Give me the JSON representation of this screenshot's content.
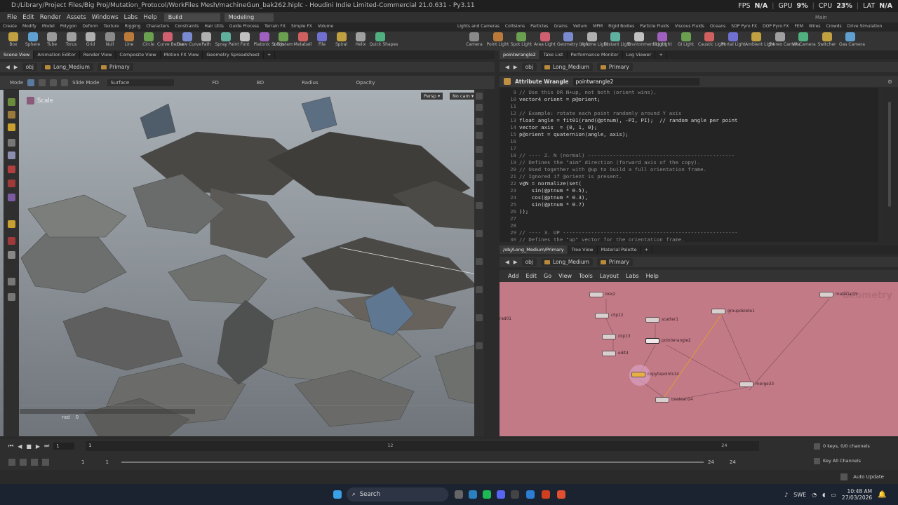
{
  "window": {
    "path": "D:/Library/Project Files/Big Proj/Mutation_Protocol/WorkFiles Mesh/machineGun_bak262.hiplc",
    "app": "Houdini Indie Limited-Commercial 21.0.631",
    "python": "Py3.11",
    "main_label": "Main"
  },
  "stats": {
    "fps_label": "FPS",
    "fps_value": "N/A",
    "gpu_label": "GPU",
    "gpu_value": "9%",
    "cpu_label": "CPU",
    "cpu_value": "23%",
    "lat_label": "LAT",
    "lat_value": "N/A"
  },
  "menu": {
    "items": [
      "File",
      "Edit",
      "Render",
      "Assets",
      "Windows",
      "Labs",
      "Help"
    ],
    "desktop1": "Build",
    "desktop2": "Modeling"
  },
  "shelf_tabs_left": [
    "Create",
    "Modify",
    "Model",
    "Polygon",
    "Deform",
    "Texture",
    "Rigging",
    "Characters",
    "Constraints",
    "Hair Utils",
    "Guide Process",
    "Terrain FX",
    "Simple FX",
    "Volume"
  ],
  "shelf_tabs_right": [
    "Lights and Cameras",
    "Collisions",
    "Particles",
    "Grains",
    "Vellum",
    "MPM",
    "Rigid Bodies",
    "Particle Fluids",
    "Viscous Fluids",
    "Oceans",
    "SOP Pyro FX",
    "DOP Pyro FX",
    "FEM",
    "Wires",
    "Crowds",
    "Drive Simulation"
  ],
  "shelf_tools_left": [
    "Box",
    "Sphere",
    "Tube",
    "Torus",
    "Grid",
    "Null",
    "Line",
    "Circle",
    "Curve Bezier",
    "Draw Curve",
    "Path",
    "Spray Paint",
    "Font",
    "Platonic Solids",
    "L-System",
    "Metaball",
    "File",
    "Spiral",
    "Helix",
    "Quick Shapes"
  ],
  "shelf_tools_right": [
    "Camera",
    "Point Light",
    "Spot Light",
    "Area Light",
    "Geometry Light",
    "Volume Light",
    "Distant Light",
    "Environment Light",
    "Sky Light",
    "GI Light",
    "Caustic Light",
    "Portal Light",
    "Ambient Light",
    "Stereo Camera",
    "VR Camera",
    "Switcher",
    "Gas Camera"
  ],
  "left_tabs": [
    "Scene View",
    "Animation Editor",
    "Render View",
    "Composite View",
    "Motion FX View",
    "Geometry Spreadsheet"
  ],
  "right_tabs_top": [
    "pointwrangle2",
    "Take List",
    "Performance Monitor",
    "Log Viewer"
  ],
  "right_tabs_bottom": [
    "/obj/Long_Medium/Primary",
    "Tree View",
    "Material Palette"
  ],
  "path": {
    "obj": "obj",
    "geo": "Long_Medium",
    "node": "Primary"
  },
  "viewport": {
    "mode_label": "Mode",
    "slide_mode": "Slide Mode",
    "surface": "Surface",
    "fd": "FD",
    "bd": "BD",
    "radius": "Radius",
    "opacity": "Opacity",
    "tool": "Scale",
    "persp": "Persp",
    "cam": "No cam",
    "rad_label": "rad",
    "rad_value": "0"
  },
  "wrangle": {
    "title": "Attribute Wrangle",
    "name": "pointwrangle2"
  },
  "code_lines": [
    {
      "n": "9",
      "t": "// Use this OR N+up, not both (orient wins)."
    },
    {
      "n": "10",
      "t": "vector4 orient = p@orient;"
    },
    {
      "n": "11",
      "t": ""
    },
    {
      "n": "12",
      "t": "// Example: rotate each point randomly around Y axis"
    },
    {
      "n": "13",
      "t": "float angle = fit01(rand(@ptnum), -PI, PI);  // random angle per point"
    },
    {
      "n": "14",
      "t": "vector axis  = {0, 1, 0};"
    },
    {
      "n": "15",
      "t": "p@orient = quaternion(angle, axis);"
    },
    {
      "n": "16",
      "t": ""
    },
    {
      "n": "17",
      "t": ""
    },
    {
      "n": "18",
      "t": "// ---- 2. N (normal) -----------------------------------------------"
    },
    {
      "n": "19",
      "t": "// Defines the \"aim\" direction (forward axis of the copy)."
    },
    {
      "n": "20",
      "t": "// Used together with @up to build a full orientation frame."
    },
    {
      "n": "21",
      "t": "// Ignored if @orient is present."
    },
    {
      "n": "22",
      "t": "v@N = normalize(set("
    },
    {
      "n": "23",
      "t": "    sin(@ptnum * 0.5),"
    },
    {
      "n": "24",
      "t": "    cos(@ptnum * 0.3),"
    },
    {
      "n": "25",
      "t": "    sin(@ptnum * 0.7)"
    },
    {
      "n": "26",
      "t": "));"
    },
    {
      "n": "27",
      "t": ""
    },
    {
      "n": "28",
      "t": ""
    },
    {
      "n": "29",
      "t": "// ---- 3. UP --------------------------------------------------------"
    },
    {
      "n": "30",
      "t": "// Defines the \"up\" vector for the orientation frame."
    }
  ],
  "net_menu": [
    "Add",
    "Edit",
    "Go",
    "View",
    "Tools",
    "Layout",
    "Labs",
    "Help"
  ],
  "net_watermark": "Geometry",
  "nodes": [
    {
      "label": "box2"
    },
    {
      "label": "clip12"
    },
    {
      "label": "scatter1"
    },
    {
      "label": "groupdelete1"
    },
    {
      "label": "clip13"
    },
    {
      "label": "pointwrangle2"
    },
    {
      "label": "edit4"
    },
    {
      "label": "copytopoints14"
    },
    {
      "label": "boolean14"
    },
    {
      "label": "merge33"
    },
    {
      "label": "material15"
    },
    {
      "label": "rad01"
    }
  ],
  "timeline": {
    "frame": "1",
    "start": "1",
    "start2": "1",
    "end": "24",
    "end2": "24",
    "keys": "0 keys, 0/0 channels",
    "all_channels": "Key All Channels",
    "auto_update": "Auto Update",
    "ticks": [
      "1",
      "12",
      "24"
    ]
  },
  "taskbar": {
    "search": "Search",
    "lang": "SWE",
    "time": "10:48 AM",
    "date": "27/03/2026"
  }
}
